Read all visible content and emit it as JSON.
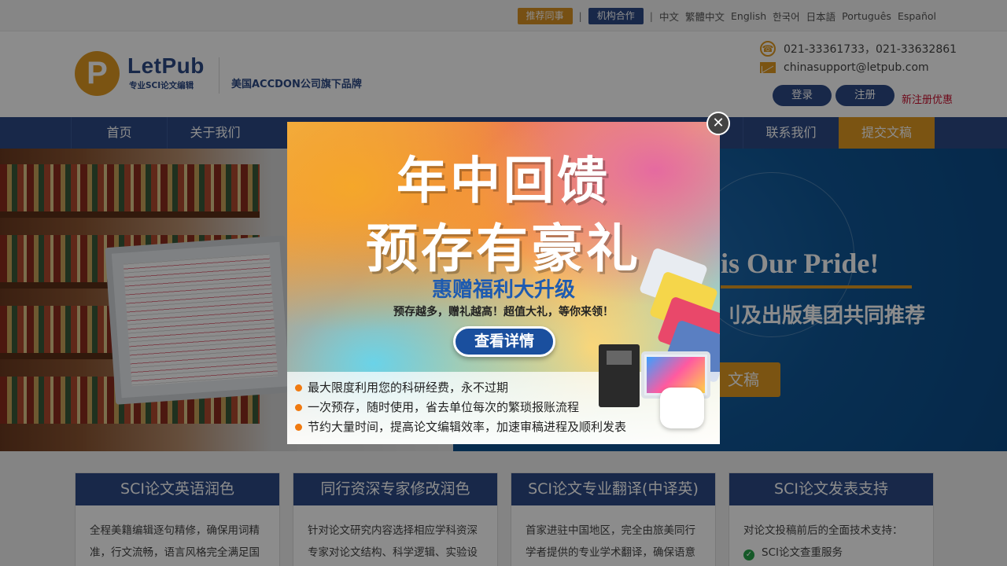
{
  "topbar": {
    "refer_label": "推荐同事",
    "partner_label": "机构合作",
    "languages": [
      "中文",
      "繁體中文",
      "English",
      "한국어",
      "日本語",
      "Português",
      "Español"
    ]
  },
  "header": {
    "logo_letter": "P",
    "logo_text": "LetPub",
    "logo_sub": "专业SCI论文编辑",
    "brand": "美国ACCDON公司旗下品牌",
    "phone": "021-33361733，021-33632861",
    "email": "chinasupport@letpub.com",
    "login_label": "登录",
    "register_label": "注册",
    "promo_label": "新注册优惠"
  },
  "nav": {
    "items": [
      "首页",
      "关于我们",
      "联系我们",
      "提交文稿"
    ]
  },
  "banner": {
    "title": "is Our Pride!",
    "subtitle": "刂及出版集团共同推荐",
    "button_label": "文稿"
  },
  "services": [
    {
      "title": "SCI论文英语润色",
      "lines": [
        "全程美籍编辑逐句精修，确保用词精",
        "准，行文流畅，语言风格完全满足国"
      ]
    },
    {
      "title": "同行资深专家修改润色",
      "lines": [
        "针对论文研究内容选择相应学科资深",
        "专家对论文结构、科学逻辑、实验设"
      ]
    },
    {
      "title": "SCI论文专业翻译(中译英)",
      "lines": [
        "首家进驻中国地区，完全由旅美同行",
        "学者提供的专业学术翻译，确保语意"
      ]
    },
    {
      "title": "SCI论文发表支持",
      "lines": [
        "对论文投稿前后的全面技术支持：",
        "SCI论文查重服务"
      ]
    }
  ],
  "modal": {
    "title1": "年中回馈",
    "title2": "预存有豪礼",
    "subtitle": "惠赠福利大升级",
    "tagline": "预存越多，赠礼越高！超值大礼，等你来领！",
    "button_label": "查看详情",
    "bullets": [
      "最大限度利用您的科研经费，永不过期",
      "一次预存，随时使用，省去单位每次的繁琐报账流程",
      "节约大量时间，提高论文编辑效率，加速审稿进程及顺利发表"
    ],
    "close_glyph": "✕"
  },
  "colors": {
    "brand_blue": "#2c4a86",
    "brand_orange": "#e09a22",
    "promo_red": "#c8102e"
  },
  "icons": [
    "phone-icon",
    "mail-icon",
    "check-icon",
    "close-icon"
  ]
}
